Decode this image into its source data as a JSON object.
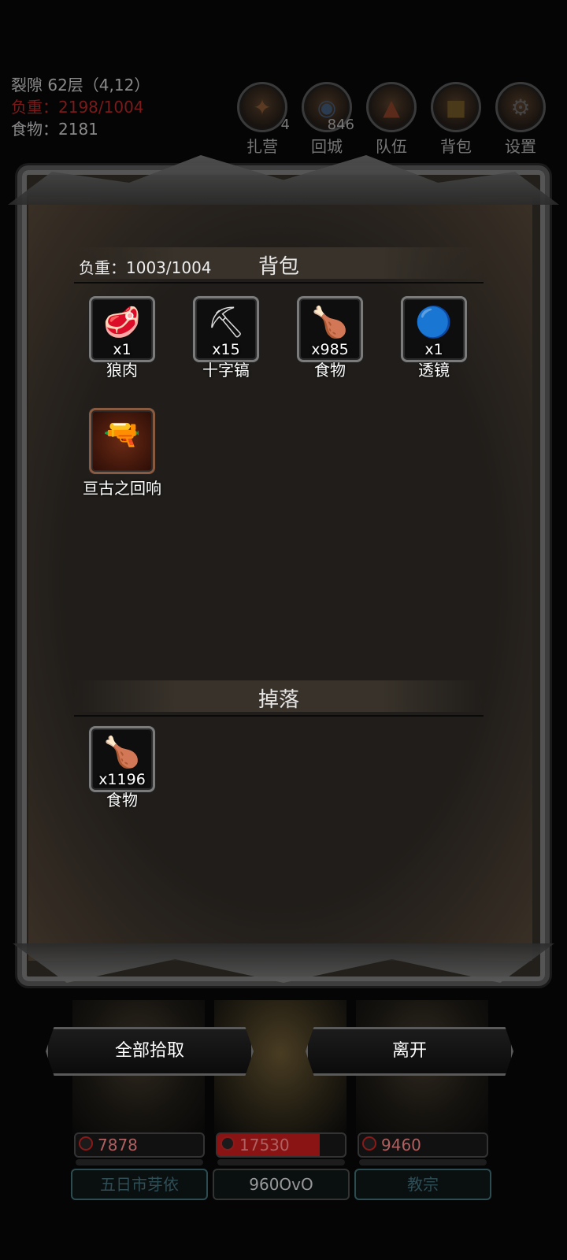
{
  "hud": {
    "location": "裂隙 62层（4,12）",
    "load": "负重：2198/1004",
    "food": "食物：2181"
  },
  "nav": [
    {
      "label": "扎营",
      "count": "4",
      "icon": "camp-icon"
    },
    {
      "label": "回城",
      "count": "846",
      "icon": "portal-icon"
    },
    {
      "label": "队伍",
      "count": "",
      "icon": "team-icon"
    },
    {
      "label": "背包",
      "count": "",
      "icon": "backpack-icon"
    },
    {
      "label": "设置",
      "count": "",
      "icon": "gear-icon"
    }
  ],
  "backpack": {
    "title": "背包",
    "weight": "负重：1003/1004",
    "items": [
      {
        "qty": "x1",
        "name": "狼肉",
        "icon": "meat-icon",
        "glyph": "🥩"
      },
      {
        "qty": "x15",
        "name": "十字镐",
        "icon": "pickaxe-icon",
        "glyph": "⛏"
      },
      {
        "qty": "x985",
        "name": "食物",
        "icon": "drumstick-icon",
        "glyph": "🍗"
      },
      {
        "qty": "x1",
        "name": "透镜",
        "icon": "lens-orb-icon",
        "glyph": "🔵"
      },
      {
        "qty": "",
        "name": "亘古之回响",
        "icon": "pistol-icon",
        "glyph": "🔫"
      }
    ]
  },
  "drops": {
    "title": "掉落",
    "items": [
      {
        "qty": "x1196",
        "name": "食物",
        "icon": "drumstick-icon",
        "glyph": "🍗"
      }
    ]
  },
  "buttons": {
    "pickup_all": "全部拾取",
    "leave": "离开"
  },
  "heroes": [
    {
      "hp": "7878",
      "hp_fraction": 0.0,
      "name": "五日市芽依"
    },
    {
      "hp": "17530",
      "hp_fraction": 0.8,
      "name": "960OvO"
    },
    {
      "hp": "9460",
      "hp_fraction": 0.0,
      "name": "教宗"
    }
  ]
}
